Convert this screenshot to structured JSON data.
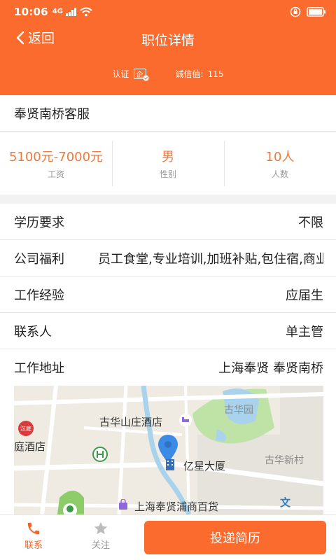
{
  "status_bar": {
    "time": "10:06",
    "network": "4G"
  },
  "nav": {
    "back_label": "返回",
    "title": "职位详情"
  },
  "credentials": {
    "cert_label": "认证",
    "cert_badge": "企",
    "credit_label": "诚信值:",
    "credit_value": "115"
  },
  "job": {
    "title": "奉贤南桥客服"
  },
  "stats": [
    {
      "value": "5100元-7000元",
      "label": "工资"
    },
    {
      "value": "男",
      "label": "性别"
    },
    {
      "value": "10人",
      "label": "人数"
    }
  ],
  "details": {
    "education": {
      "label": "学历要求",
      "value": "不限"
    },
    "benefits": {
      "label": "公司福利",
      "value": "员工食堂,专业培训,加班补贴,包住宿,商业保险"
    },
    "experience": {
      "label": "工作经验",
      "value": "应届生"
    },
    "contact": {
      "label": "联系人",
      "value": "单主管"
    },
    "address": {
      "label": "工作地址",
      "value": "上海奉贤 奉贤南桥"
    }
  },
  "map": {
    "labels": {
      "hotel_left": "庭酒店",
      "hotel_guhua": "古华山庄酒店",
      "park": "古华园",
      "building": "亿星大厦",
      "village": "古华新村",
      "store": "上海奉贤浦商百货"
    },
    "pin_color": "#3b8be6",
    "brand_icon_text": "汉庭",
    "text_icon": "文"
  },
  "bottom": {
    "contact_label": "联系",
    "follow_label": "关注",
    "apply_label": "投递简历"
  },
  "colors": {
    "brand": "#fb6b2d",
    "accent_text": "#f07a3f"
  }
}
